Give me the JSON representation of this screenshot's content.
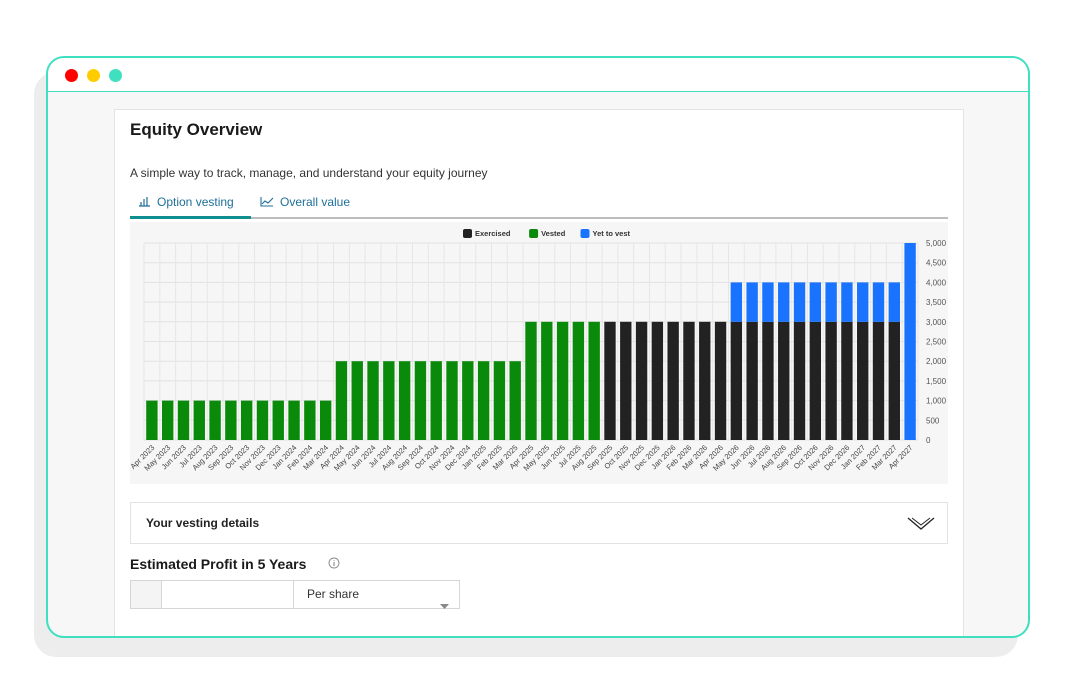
{
  "window": {
    "border_color": "#3ee0c0"
  },
  "page": {
    "title": "Equity Overview",
    "subtitle": "A simple way to track, manage, and understand your equity journey"
  },
  "tabs": [
    {
      "label": "Option vesting",
      "icon": "bar-chart-icon",
      "active": true
    },
    {
      "label": "Overall value",
      "icon": "line-chart-icon",
      "active": false
    }
  ],
  "chart_data": {
    "type": "bar",
    "stacked": true,
    "categories": [
      "Apr 2023",
      "May 2023",
      "Jun 2023",
      "Jul 2023",
      "Aug 2023",
      "Sep 2023",
      "Oct 2023",
      "Nov 2023",
      "Dec 2023",
      "Jan 2024",
      "Feb 2024",
      "Mar 2024",
      "Apr 2024",
      "May 2024",
      "Jun 2024",
      "Jul 2024",
      "Aug 2024",
      "Sep 2024",
      "Oct 2024",
      "Nov 2024",
      "Dec 2024",
      "Jan 2025",
      "Feb 2025",
      "Mar 2025",
      "Apr 2025",
      "May 2025",
      "Jun 2025",
      "Jul 2025",
      "Aug 2025",
      "Sep 2025",
      "Oct 2025",
      "Nov 2025",
      "Dec 2025",
      "Jan 2026",
      "Feb 2026",
      "Mar 2026",
      "Apr 2026",
      "May 2026",
      "Jun 2026",
      "Jul 2026",
      "Aug 2026",
      "Sep 2026",
      "Oct 2026",
      "Nov 2026",
      "Dec 2026",
      "Jan 2027",
      "Feb 2027",
      "Mar 2027",
      "Apr 2027"
    ],
    "series": [
      {
        "name": "Exercised",
        "color": "#222222",
        "values": [
          0,
          0,
          0,
          0,
          0,
          0,
          0,
          0,
          0,
          0,
          0,
          0,
          0,
          0,
          0,
          0,
          0,
          0,
          0,
          0,
          0,
          0,
          0,
          0,
          0,
          0,
          0,
          0,
          0,
          3000,
          3000,
          3000,
          3000,
          3000,
          3000,
          3000,
          3000,
          3000,
          3000,
          3000,
          3000,
          3000,
          3000,
          3000,
          3000,
          3000,
          3000,
          3000,
          0
        ]
      },
      {
        "name": "Vested",
        "color": "#0a8a0a",
        "values": [
          1000,
          1000,
          1000,
          1000,
          1000,
          1000,
          1000,
          1000,
          1000,
          1000,
          1000,
          1000,
          2000,
          2000,
          2000,
          2000,
          2000,
          2000,
          2000,
          2000,
          2000,
          2000,
          2000,
          2000,
          3000,
          3000,
          3000,
          3000,
          3000,
          0,
          0,
          0,
          0,
          0,
          0,
          0,
          0,
          0,
          0,
          0,
          0,
          0,
          0,
          0,
          0,
          0,
          0,
          0,
          0
        ]
      },
      {
        "name": "Yet to vest",
        "color": "#1a73ff",
        "values": [
          0,
          0,
          0,
          0,
          0,
          0,
          0,
          0,
          0,
          0,
          0,
          0,
          0,
          0,
          0,
          0,
          0,
          0,
          0,
          0,
          0,
          0,
          0,
          0,
          0,
          0,
          0,
          0,
          0,
          0,
          0,
          0,
          0,
          0,
          0,
          0,
          0,
          1000,
          1000,
          1000,
          1000,
          1000,
          1000,
          1000,
          1000,
          1000,
          1000,
          1000,
          5000
        ]
      }
    ],
    "y_ticks": [
      "0",
      "500",
      "1,000",
      "1,500",
      "2,000",
      "2,500",
      "3,000",
      "3,500",
      "4,000",
      "4,500",
      "5,000"
    ],
    "ylim": [
      0,
      5000
    ],
    "grid": true,
    "legend": "top-center",
    "y_axis_side": "right"
  },
  "vesting_details": {
    "label": "Your vesting details"
  },
  "profit": {
    "title": "Estimated Profit in 5 Years",
    "input_value": "",
    "select_value": "Per share"
  }
}
